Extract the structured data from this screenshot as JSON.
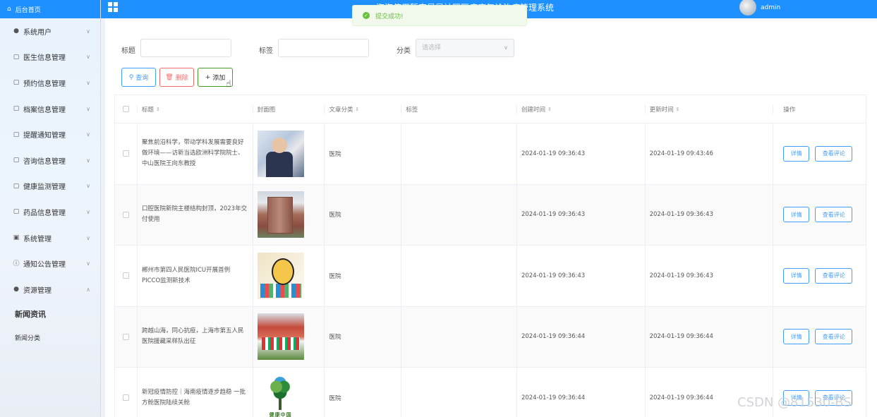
{
  "sidebar": {
    "home": "后台首页",
    "items": [
      {
        "label": "系统用户",
        "icon": "user-icon"
      },
      {
        "label": "医生信息管理",
        "icon": "document-icon"
      },
      {
        "label": "预约信息管理",
        "icon": "document-icon"
      },
      {
        "label": "档案信息管理",
        "icon": "document-icon"
      },
      {
        "label": "提醒通知管理",
        "icon": "document-icon"
      },
      {
        "label": "咨询信息管理",
        "icon": "document-icon"
      },
      {
        "label": "健康监测管理",
        "icon": "document-icon"
      },
      {
        "label": "药品信息管理",
        "icon": "document-icon"
      },
      {
        "label": "系统管理",
        "icon": "image-icon"
      },
      {
        "label": "通知公告管理",
        "icon": "info-icon"
      },
      {
        "label": "资源管理",
        "icon": "location-icon"
      }
    ],
    "sub_items": [
      "新闻资讯",
      "新闻分类"
    ]
  },
  "header": {
    "title": "海海使用暂定是是社区医疗康复诊治疗管理系统",
    "user": "admin"
  },
  "toast": {
    "text": "提交成功!"
  },
  "filters": {
    "title_label": "标题",
    "tag_label": "标签",
    "category_label": "分类",
    "category_placeholder": "请选择"
  },
  "buttons": {
    "query": "查询",
    "delete": "删除",
    "add": "添加"
  },
  "table": {
    "headers": [
      "标题",
      "封面图",
      "文章分类",
      "标签",
      "创建时间",
      "更新时间",
      "操作"
    ],
    "rows": [
      {
        "title": "聚焦前沿科学，带动学科发展需要良好做环境——访新当选欧洲科学院院士、中山医院王向东教授",
        "category": "医院",
        "tag": "",
        "created": "2024-01-19 09:36:43",
        "updated": "2024-01-19 09:43:46"
      },
      {
        "title": "口腔医院新院主楼结构封顶，2023年交付使用",
        "category": "医院",
        "tag": "",
        "created": "2024-01-19 09:36:43",
        "updated": "2024-01-19 09:36:43"
      },
      {
        "title": "郴州市第四人民医院ICU开展首例PICCO监测新技术",
        "category": "医院",
        "tag": "",
        "created": "2024-01-19 09:36:43",
        "updated": "2024-01-19 09:36:43"
      },
      {
        "title": "跨越山海，同心抗疫，上海市第五人民医院援藏采样队出征",
        "category": "医院",
        "tag": "",
        "created": "2024-01-19 09:36:44",
        "updated": "2024-01-19 09:36:44"
      },
      {
        "title": "新冠疫情防控｜海南疫情逐步趋稳 一批方舱医院陆续关舱",
        "category": "医院",
        "tag": "",
        "created": "2024-01-19 09:36:44",
        "updated": "2024-01-19 09:36:44"
      }
    ],
    "action_detail": "详情",
    "action_comments": "查看评论",
    "thumb5_caption": "健康中国"
  },
  "watermark": "CSDN @81530-BS"
}
